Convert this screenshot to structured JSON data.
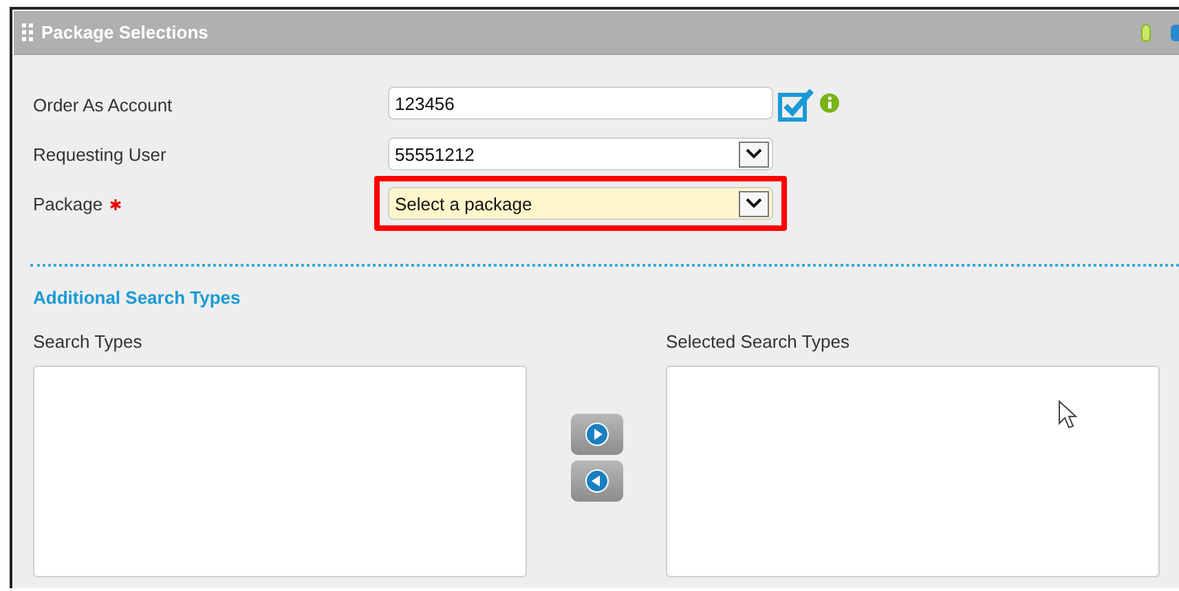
{
  "panel": {
    "title": "Package Selections"
  },
  "fields": [
    {
      "kind": "text",
      "label": "Order As Account",
      "value": "123456",
      "required": false,
      "highlighted": false
    },
    {
      "kind": "select",
      "label": "Requesting User",
      "value": "55551212",
      "required": false,
      "highlighted": false
    },
    {
      "kind": "select",
      "label": "Package",
      "value": "Select a package",
      "required": true,
      "highlighted": true
    }
  ],
  "section": {
    "title": "Additional Search Types"
  },
  "lists": [
    {
      "label": "Search Types"
    },
    {
      "label": "Selected Search Types"
    }
  ]
}
